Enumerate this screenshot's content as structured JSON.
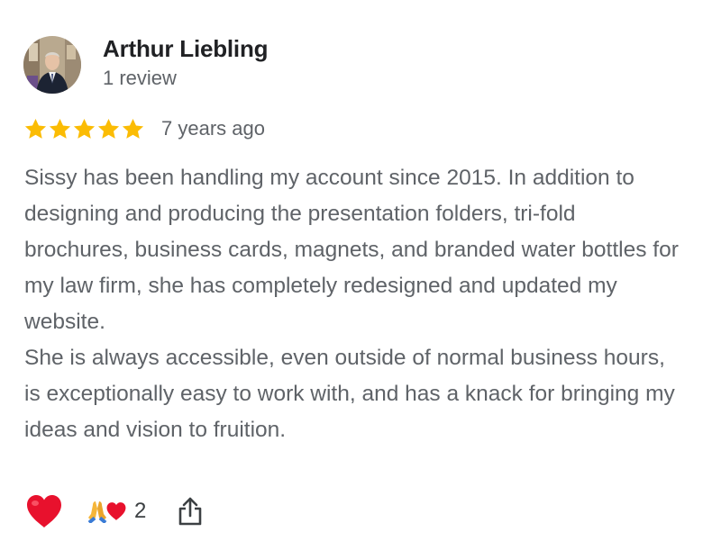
{
  "review": {
    "author_name": "Arthur Liebling",
    "author_review_count": "1 review",
    "rating": 5,
    "rating_max": 5,
    "timestamp": "7 years ago",
    "paragraphs": [
      "Sissy has been handling my account since 2015. In addition to designing and producing the presentation folders, tri-fold brochures, business cards, magnets, and branded water bottles for my law firm, she has completely redesigned and updated my website.",
      "She is always accessible, even outside of normal business hours, is exceptionally easy to work with, and has a knack for bringing my ideas and vision to fruition."
    ]
  },
  "actions": {
    "heart_icon": "heart-icon",
    "reactions_icons": [
      "folded-hands-icon",
      "heart-icon"
    ],
    "reaction_count": "2",
    "share_icon": "share-icon"
  },
  "colors": {
    "star": "#fbbc04",
    "heart": "#e8112d",
    "text_primary": "#202124",
    "text_secondary": "#5f6368"
  }
}
